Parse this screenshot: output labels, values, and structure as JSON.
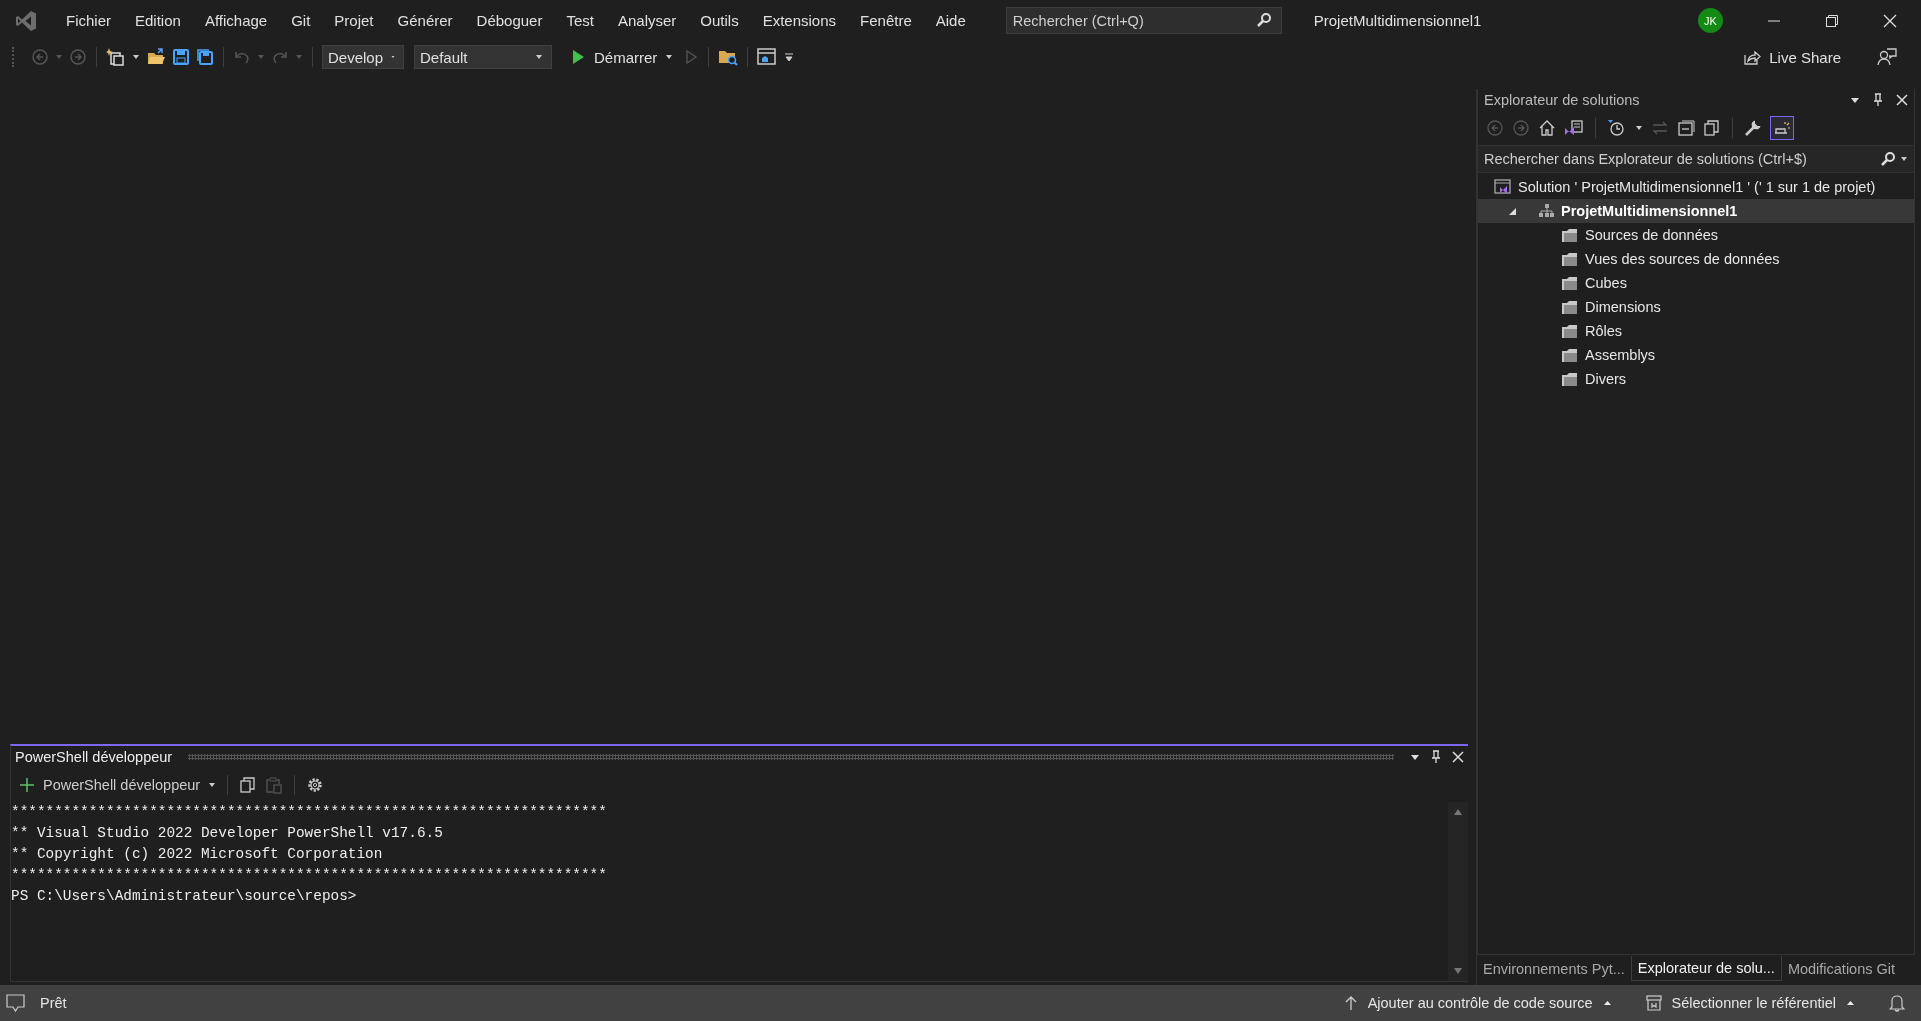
{
  "menu": [
    "Fichier",
    "Edition",
    "Affichage",
    "Git",
    "Projet",
    "Générer",
    "Déboguer",
    "Test",
    "Analyser",
    "Outils",
    "Extensions",
    "Fenêtre",
    "Aide"
  ],
  "search": {
    "placeholder": "Rechercher (Ctrl+Q)"
  },
  "window": {
    "title": "ProjetMultidimensionnel1"
  },
  "account": {
    "initials": "JK"
  },
  "toolbar": {
    "configuration": "Develop",
    "platform": "Default",
    "start": "Démarrer",
    "live_share": "Live Share"
  },
  "terminal": {
    "title": "PowerShell développeur",
    "profile": "PowerShell développeur",
    "lines": [
      "*********************************************************************",
      "** Visual Studio 2022 Developer PowerShell v17.6.5",
      "** Copyright (c) 2022 Microsoft Corporation",
      "*********************************************************************",
      "PS C:\\Users\\Administrateur\\source\\repos>"
    ]
  },
  "solution_explorer": {
    "title": "Explorateur de solutions",
    "search_placeholder": "Rechercher dans Explorateur de solutions (Ctrl+$)",
    "preview_on": true,
    "tree": [
      {
        "label": "Solution ' ProjetMultidimensionnel1 ' (' 1 sur 1 de projet)",
        "kind": "solution",
        "selected": false,
        "children": [
          {
            "label": "ProjetMultidimensionnel1",
            "kind": "project",
            "selected": true,
            "expanded": true,
            "children": [
              {
                "label": "Sources de données",
                "kind": "folder",
                "selected": false
              },
              {
                "label": "Vues des sources de données",
                "kind": "folder",
                "selected": false
              },
              {
                "label": "Cubes",
                "kind": "folder",
                "selected": false
              },
              {
                "label": "Dimensions",
                "kind": "folder",
                "selected": false
              },
              {
                "label": "Rôles",
                "kind": "folder",
                "selected": false
              },
              {
                "label": "Assemblys",
                "kind": "folder",
                "selected": false
              },
              {
                "label": "Divers",
                "kind": "folder",
                "selected": false
              }
            ]
          }
        ]
      }
    ],
    "tabs": [
      {
        "label": "Environnements Pyt...",
        "selected": false
      },
      {
        "label": "Explorateur de solu...",
        "selected": true
      },
      {
        "label": "Modifications Git",
        "selected": false
      }
    ]
  },
  "status_bar": {
    "status": "Prêt",
    "source_control": "Ajouter au contrôle de code source",
    "repository": "Sélectionner le référentiel"
  }
}
